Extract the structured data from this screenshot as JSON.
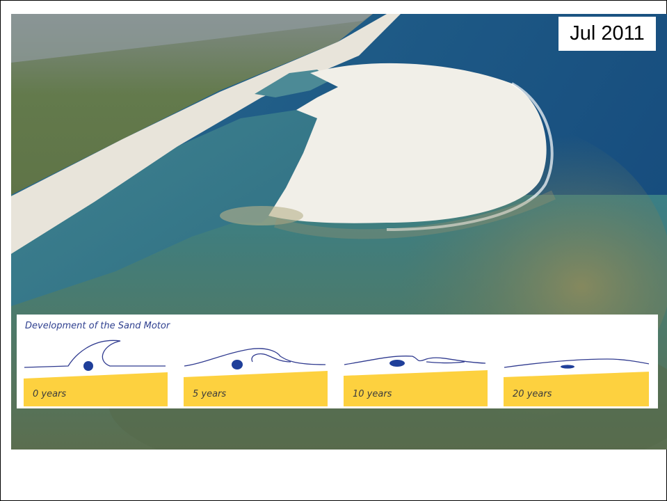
{
  "slide": {
    "date_label": "Jul 2011",
    "photo_icon": "aerial-sand-motor-photo",
    "diagram": {
      "title": "Development of the Sand Motor",
      "stages": [
        {
          "label": "0 years"
        },
        {
          "label": "5 years"
        },
        {
          "label": "10 years"
        },
        {
          "label": "20 years"
        }
      ],
      "colors": {
        "sand": "#fdd13f",
        "outline": "#2f3a8f",
        "lagoon": "#1f3f9a"
      }
    }
  }
}
